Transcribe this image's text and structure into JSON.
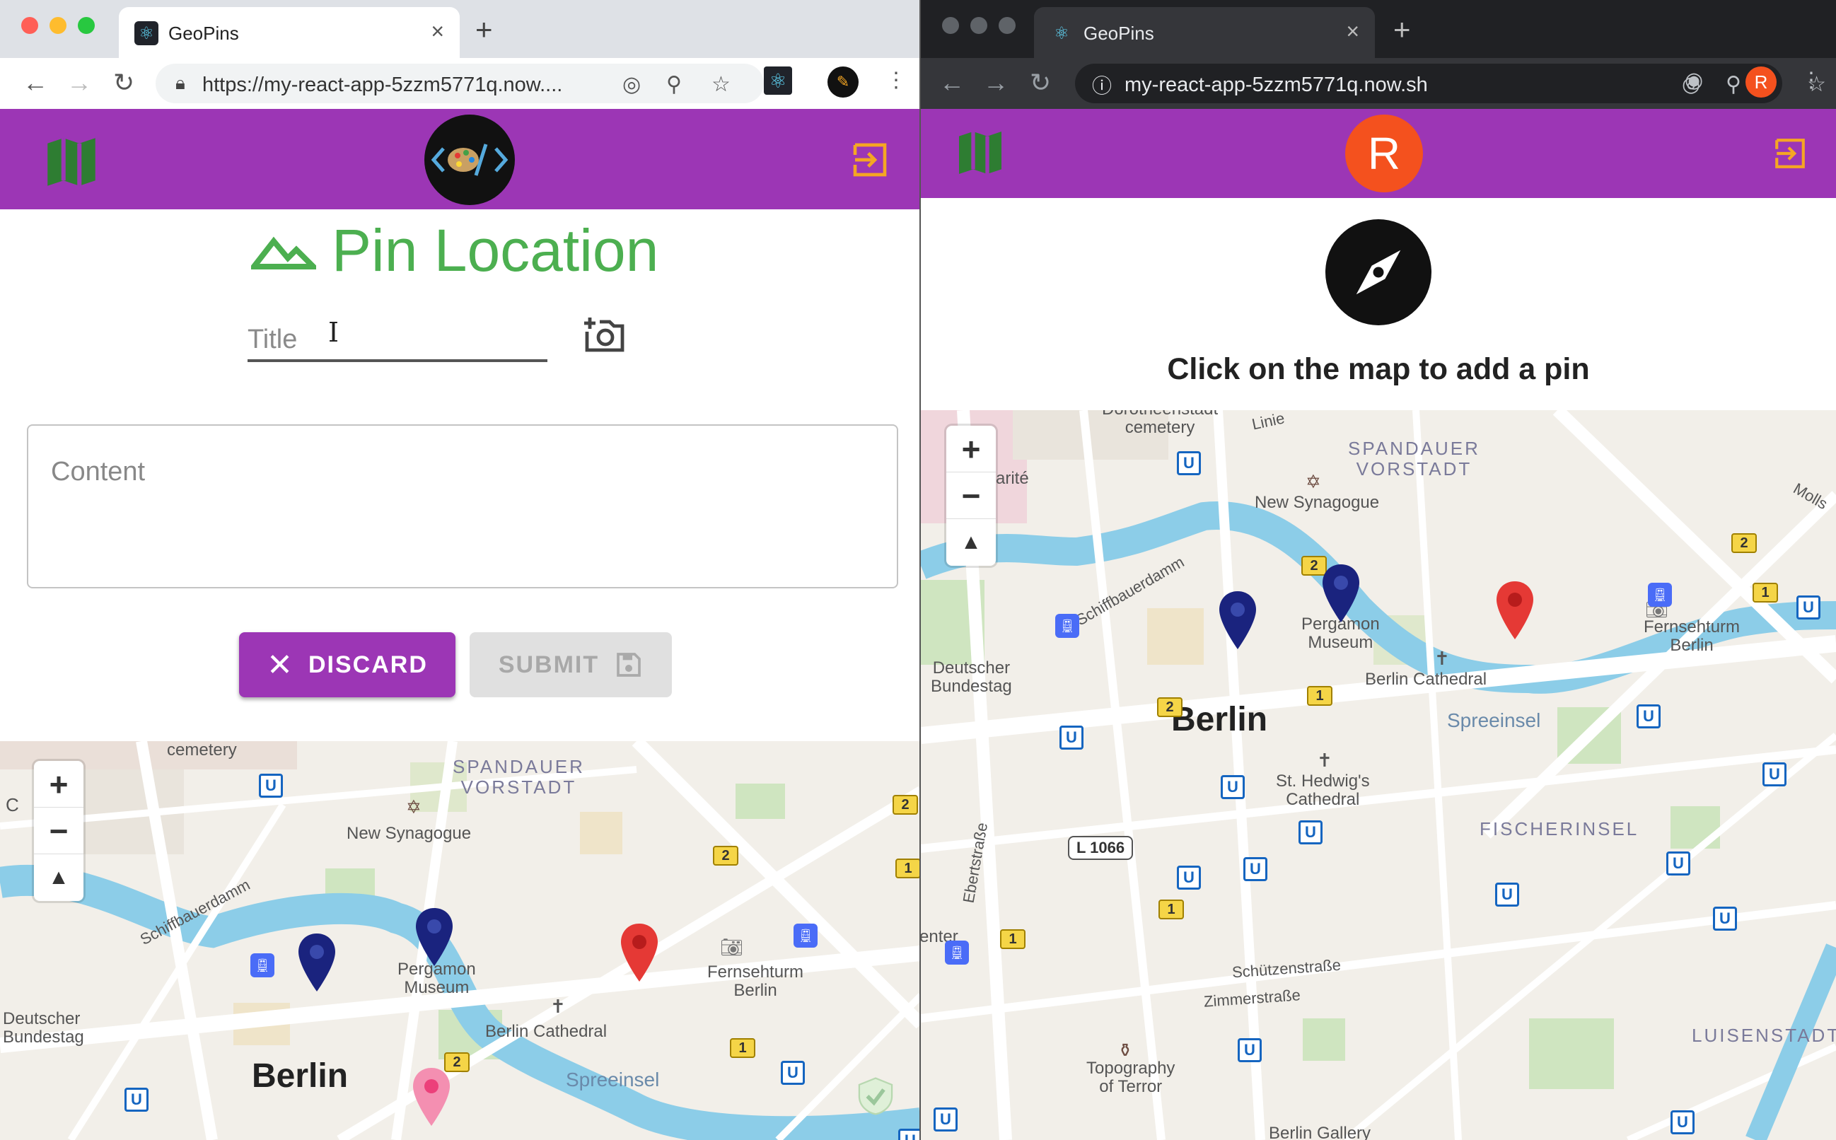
{
  "left_window": {
    "tab_title": "GeoPins",
    "url": "https://my-react-app-5zzm5771q.now....",
    "heading": "Pin Location",
    "title_placeholder": "Title",
    "content_placeholder": "Content",
    "discard_label": "DISCARD",
    "submit_label": "SUBMIT",
    "map": {
      "labels": {
        "cemetery": "cemetery",
        "district": "SPANDAUER\nVORSTADT",
        "synagogue": "New Synagogue",
        "river": "Schiffbauerdamm",
        "museum": "Pergamon\nMuseum",
        "tower": "Fernsehturm\nBerlin",
        "bundestag": "Deutscher\nBundestag",
        "cathedral": "Berlin Cathedral",
        "city": "Berlin",
        "island": "Spreeinsel",
        "edge_c": "C"
      },
      "zoom_in": "+",
      "zoom_out": "−",
      "compass": "▲"
    }
  },
  "right_window": {
    "tab_title": "GeoPins",
    "url": "my-react-app-5zzm5771q.now.sh",
    "avatar_letter": "R",
    "profile_letter": "R",
    "hint": "Click on the map to add a pin",
    "map": {
      "labels": {
        "cemetery_top": "Dorotheenstadt\ncemetery",
        "linie": "Linie",
        "district": "SPANDAUER\nVORSTADT",
        "synagogue": "New Synagogue",
        "molls": "Molls",
        "charite": "arité",
        "river": "Schiffbauerdamm",
        "museum": "Pergamon\nMuseum",
        "tower": "Fernsehturm\nBerlin",
        "bundestag": "Deutscher\nBundestag",
        "cathedral": "Berlin Cathedral",
        "city": "Berlin",
        "island": "Spreeinsel",
        "hedwig": "St. Hedwig's\nCathedral",
        "fischer": "FISCHERINSEL",
        "ebert": "Ebertstraße",
        "l1066": "L 1066",
        "enter": "enter",
        "schuetzen": "Schützenstraße",
        "zimmer": "Zimmerstraße",
        "topo": "Topography\nof Terror",
        "luisen": "LUISENSTADT",
        "gallery": "Berlin Gallery"
      },
      "zoom_in": "+",
      "zoom_out": "−",
      "compass": "▲"
    }
  },
  "shared": {
    "u_symbol": "U",
    "badge_1": "1",
    "badge_2": "2",
    "close_symbol": "×",
    "newtab_symbol": "+",
    "ibeam": "I"
  },
  "colors": {
    "appbar": "#9c36b5",
    "accent_green": "#4caf50",
    "signout_orange": "#f5a623",
    "avatar_orange": "#f4511e",
    "pin_blue": "#1a237e",
    "pin_red": "#e53935",
    "pin_pink": "#f48fb1"
  }
}
